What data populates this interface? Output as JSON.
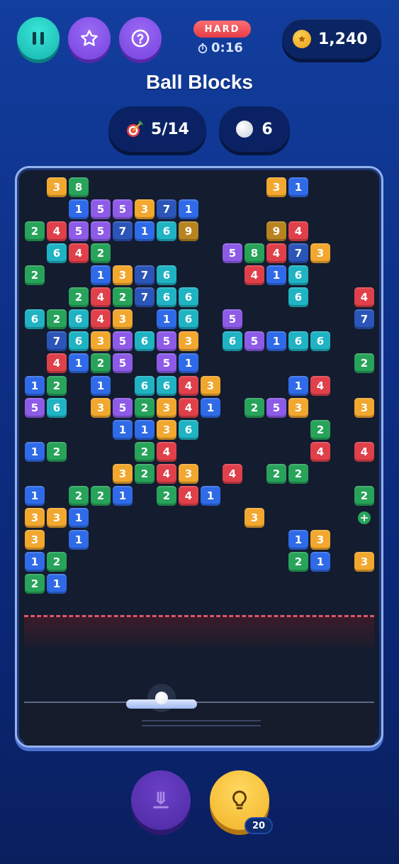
{
  "game_title": "Ball Blocks",
  "hud": {
    "difficulty": "HARD",
    "timer": "0:16",
    "coins": "1,240",
    "targets": "5/14",
    "balls": "6"
  },
  "controls": {
    "pause_icon": "pause-icon",
    "star_icon": "star-icon",
    "help_icon": "help-icon",
    "drop_icon": "drop-down-icon",
    "hint_icon": "lightbulb-icon",
    "hint_count": "20"
  },
  "colors": {
    "orange": "#f2a72e",
    "green": "#27a35a",
    "blue": "#2f6be8",
    "purple": "#8d5be8",
    "teal": "#1fb3c3",
    "red": "#e0404a",
    "dark_blue": "#2b55b8",
    "gold": "#b88420",
    "accent_teal": "#2ed3c8",
    "accent_purple": "#8650ea",
    "danger": "#e05466"
  },
  "board": {
    "cols": 16,
    "rows": 19,
    "blocks": [
      {
        "c": 1,
        "r": 0,
        "v": "3",
        "color": "orange"
      },
      {
        "c": 2,
        "r": 0,
        "v": "8",
        "color": "green"
      },
      {
        "c": 11,
        "r": 0,
        "v": "3",
        "color": "orange"
      },
      {
        "c": 12,
        "r": 0,
        "v": "1",
        "color": "blue"
      },
      {
        "c": 2,
        "r": 1,
        "v": "1",
        "color": "blue"
      },
      {
        "c": 3,
        "r": 1,
        "v": "5",
        "color": "purple"
      },
      {
        "c": 4,
        "r": 1,
        "v": "5",
        "color": "purple"
      },
      {
        "c": 5,
        "r": 1,
        "v": "3",
        "color": "orange"
      },
      {
        "c": 6,
        "r": 1,
        "v": "7",
        "color": "dark_blue"
      },
      {
        "c": 7,
        "r": 1,
        "v": "1",
        "color": "blue"
      },
      {
        "c": 0,
        "r": 2,
        "v": "2",
        "color": "green"
      },
      {
        "c": 1,
        "r": 2,
        "v": "4",
        "color": "red"
      },
      {
        "c": 2,
        "r": 2,
        "v": "5",
        "color": "purple"
      },
      {
        "c": 3,
        "r": 2,
        "v": "5",
        "color": "purple"
      },
      {
        "c": 4,
        "r": 2,
        "v": "7",
        "color": "dark_blue"
      },
      {
        "c": 5,
        "r": 2,
        "v": "1",
        "color": "blue"
      },
      {
        "c": 6,
        "r": 2,
        "v": "6",
        "color": "teal"
      },
      {
        "c": 7,
        "r": 2,
        "v": "9",
        "color": "gold"
      },
      {
        "c": 11,
        "r": 2,
        "v": "9",
        "color": "gold"
      },
      {
        "c": 12,
        "r": 2,
        "v": "4",
        "color": "red"
      },
      {
        "c": 1,
        "r": 3,
        "v": "6",
        "color": "teal"
      },
      {
        "c": 2,
        "r": 3,
        "v": "4",
        "color": "red"
      },
      {
        "c": 3,
        "r": 3,
        "v": "2",
        "color": "green"
      },
      {
        "c": 9,
        "r": 3,
        "v": "5",
        "color": "purple"
      },
      {
        "c": 10,
        "r": 3,
        "v": "8",
        "color": "green"
      },
      {
        "c": 11,
        "r": 3,
        "v": "4",
        "color": "red"
      },
      {
        "c": 12,
        "r": 3,
        "v": "7",
        "color": "dark_blue"
      },
      {
        "c": 13,
        "r": 3,
        "v": "3",
        "color": "orange"
      },
      {
        "c": 0,
        "r": 4,
        "v": "2",
        "color": "green"
      },
      {
        "c": 3,
        "r": 4,
        "v": "1",
        "color": "blue"
      },
      {
        "c": 4,
        "r": 4,
        "v": "3",
        "color": "orange"
      },
      {
        "c": 5,
        "r": 4,
        "v": "7",
        "color": "dark_blue"
      },
      {
        "c": 6,
        "r": 4,
        "v": "6",
        "color": "teal"
      },
      {
        "c": 10,
        "r": 4,
        "v": "4",
        "color": "red"
      },
      {
        "c": 11,
        "r": 4,
        "v": "1",
        "color": "blue"
      },
      {
        "c": 12,
        "r": 4,
        "v": "6",
        "color": "teal"
      },
      {
        "c": 2,
        "r": 5,
        "v": "2",
        "color": "green"
      },
      {
        "c": 3,
        "r": 5,
        "v": "4",
        "color": "red"
      },
      {
        "c": 4,
        "r": 5,
        "v": "2",
        "color": "green"
      },
      {
        "c": 5,
        "r": 5,
        "v": "7",
        "color": "dark_blue"
      },
      {
        "c": 6,
        "r": 5,
        "v": "6",
        "color": "teal"
      },
      {
        "c": 7,
        "r": 5,
        "v": "6",
        "color": "teal"
      },
      {
        "c": 12,
        "r": 5,
        "v": "6",
        "color": "teal"
      },
      {
        "c": 15,
        "r": 5,
        "v": "4",
        "color": "red"
      },
      {
        "c": 0,
        "r": 6,
        "v": "6",
        "color": "teal"
      },
      {
        "c": 1,
        "r": 6,
        "v": "2",
        "color": "green"
      },
      {
        "c": 2,
        "r": 6,
        "v": "6",
        "color": "teal"
      },
      {
        "c": 3,
        "r": 6,
        "v": "4",
        "color": "red"
      },
      {
        "c": 4,
        "r": 6,
        "v": "3",
        "color": "orange"
      },
      {
        "c": 6,
        "r": 6,
        "v": "1",
        "color": "blue"
      },
      {
        "c": 7,
        "r": 6,
        "v": "6",
        "color": "teal"
      },
      {
        "c": 9,
        "r": 6,
        "v": "5",
        "color": "purple"
      },
      {
        "c": 15,
        "r": 6,
        "v": "7",
        "color": "dark_blue"
      },
      {
        "c": 1,
        "r": 7,
        "v": "7",
        "color": "dark_blue"
      },
      {
        "c": 2,
        "r": 7,
        "v": "6",
        "color": "teal"
      },
      {
        "c": 3,
        "r": 7,
        "v": "3",
        "color": "orange"
      },
      {
        "c": 4,
        "r": 7,
        "v": "5",
        "color": "purple"
      },
      {
        "c": 5,
        "r": 7,
        "v": "6",
        "color": "teal"
      },
      {
        "c": 6,
        "r": 7,
        "v": "5",
        "color": "purple"
      },
      {
        "c": 7,
        "r": 7,
        "v": "3",
        "color": "orange"
      },
      {
        "c": 9,
        "r": 7,
        "v": "6",
        "color": "teal"
      },
      {
        "c": 10,
        "r": 7,
        "v": "5",
        "color": "purple"
      },
      {
        "c": 11,
        "r": 7,
        "v": "1",
        "color": "blue"
      },
      {
        "c": 12,
        "r": 7,
        "v": "6",
        "color": "teal"
      },
      {
        "c": 13,
        "r": 7,
        "v": "6",
        "color": "teal"
      },
      {
        "c": 1,
        "r": 8,
        "v": "4",
        "color": "red"
      },
      {
        "c": 2,
        "r": 8,
        "v": "1",
        "color": "blue"
      },
      {
        "c": 3,
        "r": 8,
        "v": "2",
        "color": "green"
      },
      {
        "c": 4,
        "r": 8,
        "v": "5",
        "color": "purple"
      },
      {
        "c": 6,
        "r": 8,
        "v": "5",
        "color": "purple"
      },
      {
        "c": 7,
        "r": 8,
        "v": "1",
        "color": "blue"
      },
      {
        "c": 15,
        "r": 8,
        "v": "2",
        "color": "green"
      },
      {
        "c": 0,
        "r": 9,
        "v": "1",
        "color": "blue"
      },
      {
        "c": 1,
        "r": 9,
        "v": "2",
        "color": "green"
      },
      {
        "c": 3,
        "r": 9,
        "v": "1",
        "color": "blue"
      },
      {
        "c": 5,
        "r": 9,
        "v": "6",
        "color": "teal"
      },
      {
        "c": 6,
        "r": 9,
        "v": "6",
        "color": "teal"
      },
      {
        "c": 7,
        "r": 9,
        "v": "4",
        "color": "red"
      },
      {
        "c": 8,
        "r": 9,
        "v": "3",
        "color": "orange"
      },
      {
        "c": 12,
        "r": 9,
        "v": "1",
        "color": "blue"
      },
      {
        "c": 13,
        "r": 9,
        "v": "4",
        "color": "red"
      },
      {
        "c": 0,
        "r": 10,
        "v": "5",
        "color": "purple"
      },
      {
        "c": 1,
        "r": 10,
        "v": "6",
        "color": "teal"
      },
      {
        "c": 3,
        "r": 10,
        "v": "3",
        "color": "orange"
      },
      {
        "c": 4,
        "r": 10,
        "v": "5",
        "color": "purple"
      },
      {
        "c": 5,
        "r": 10,
        "v": "2",
        "color": "green"
      },
      {
        "c": 6,
        "r": 10,
        "v": "3",
        "color": "orange"
      },
      {
        "c": 7,
        "r": 10,
        "v": "4",
        "color": "red"
      },
      {
        "c": 8,
        "r": 10,
        "v": "1",
        "color": "blue"
      },
      {
        "c": 10,
        "r": 10,
        "v": "2",
        "color": "green"
      },
      {
        "c": 11,
        "r": 10,
        "v": "5",
        "color": "purple"
      },
      {
        "c": 12,
        "r": 10,
        "v": "3",
        "color": "orange"
      },
      {
        "c": 15,
        "r": 10,
        "v": "3",
        "color": "orange"
      },
      {
        "c": 4,
        "r": 11,
        "v": "1",
        "color": "blue"
      },
      {
        "c": 5,
        "r": 11,
        "v": "1",
        "color": "blue"
      },
      {
        "c": 6,
        "r": 11,
        "v": "3",
        "color": "orange"
      },
      {
        "c": 7,
        "r": 11,
        "v": "6",
        "color": "teal"
      },
      {
        "c": 13,
        "r": 11,
        "v": "2",
        "color": "green"
      },
      {
        "c": 0,
        "r": 12,
        "v": "1",
        "color": "blue"
      },
      {
        "c": 1,
        "r": 12,
        "v": "2",
        "color": "green"
      },
      {
        "c": 5,
        "r": 12,
        "v": "2",
        "color": "green"
      },
      {
        "c": 6,
        "r": 12,
        "v": "4",
        "color": "red"
      },
      {
        "c": 13,
        "r": 12,
        "v": "4",
        "color": "red"
      },
      {
        "c": 15,
        "r": 12,
        "v": "4",
        "color": "red"
      },
      {
        "c": 4,
        "r": 13,
        "v": "3",
        "color": "orange"
      },
      {
        "c": 5,
        "r": 13,
        "v": "2",
        "color": "green"
      },
      {
        "c": 6,
        "r": 13,
        "v": "4",
        "color": "red"
      },
      {
        "c": 7,
        "r": 13,
        "v": "3",
        "color": "orange"
      },
      {
        "c": 9,
        "r": 13,
        "v": "4",
        "color": "red"
      },
      {
        "c": 11,
        "r": 13,
        "v": "2",
        "color": "green"
      },
      {
        "c": 12,
        "r": 13,
        "v": "2",
        "color": "green"
      },
      {
        "c": 0,
        "r": 14,
        "v": "1",
        "color": "blue"
      },
      {
        "c": 2,
        "r": 14,
        "v": "2",
        "color": "green"
      },
      {
        "c": 3,
        "r": 14,
        "v": "2",
        "color": "green"
      },
      {
        "c": 4,
        "r": 14,
        "v": "1",
        "color": "blue"
      },
      {
        "c": 6,
        "r": 14,
        "v": "2",
        "color": "green"
      },
      {
        "c": 7,
        "r": 14,
        "v": "4",
        "color": "red"
      },
      {
        "c": 8,
        "r": 14,
        "v": "1",
        "color": "blue"
      },
      {
        "c": 15,
        "r": 14,
        "v": "2",
        "color": "green"
      },
      {
        "c": 0,
        "r": 15,
        "v": "3",
        "color": "orange"
      },
      {
        "c": 1,
        "r": 15,
        "v": "3",
        "color": "orange"
      },
      {
        "c": 2,
        "r": 15,
        "v": "1",
        "color": "blue"
      },
      {
        "c": 10,
        "r": 15,
        "v": "3",
        "color": "orange"
      },
      {
        "c": 0,
        "r": 16,
        "v": "3",
        "color": "orange"
      },
      {
        "c": 2,
        "r": 16,
        "v": "1",
        "color": "blue"
      },
      {
        "c": 12,
        "r": 16,
        "v": "1",
        "color": "blue"
      },
      {
        "c": 13,
        "r": 16,
        "v": "3",
        "color": "orange"
      },
      {
        "c": 0,
        "r": 17,
        "v": "1",
        "color": "blue"
      },
      {
        "c": 1,
        "r": 17,
        "v": "2",
        "color": "green"
      },
      {
        "c": 12,
        "r": 17,
        "v": "2",
        "color": "green"
      },
      {
        "c": 13,
        "r": 17,
        "v": "1",
        "color": "blue"
      },
      {
        "c": 15,
        "r": 17,
        "v": "3",
        "color": "orange"
      },
      {
        "c": 0,
        "r": 18,
        "v": "2",
        "color": "green"
      },
      {
        "c": 1,
        "r": 18,
        "v": "1",
        "color": "blue"
      }
    ],
    "bonus_items": [
      {
        "c": 15,
        "r": 15,
        "type": "extra-ball",
        "symbol": "+"
      }
    ]
  }
}
